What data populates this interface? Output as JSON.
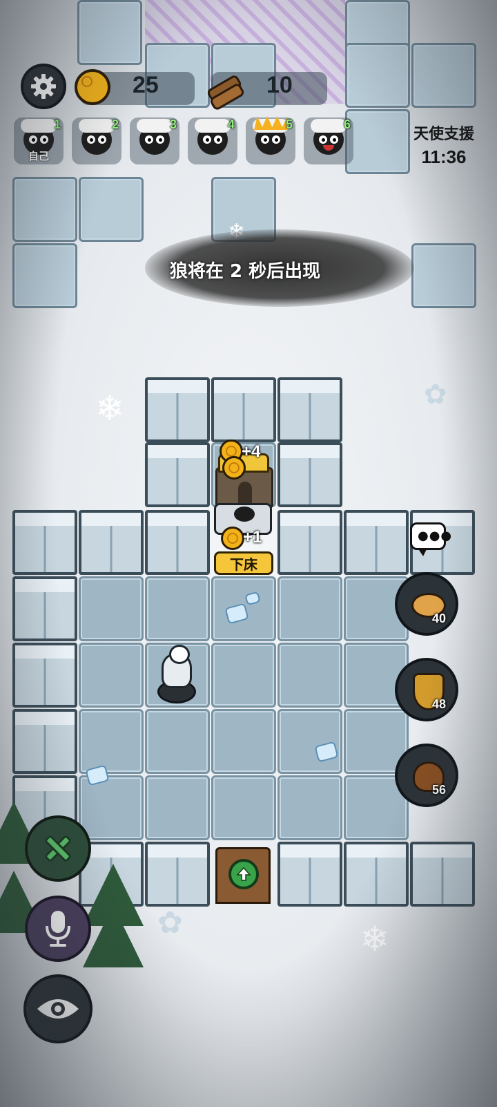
{
  "hud": {
    "coins": "25",
    "wood": "10"
  },
  "players": [
    {
      "num": "1",
      "label": "自己"
    },
    {
      "num": "2",
      "label": ""
    },
    {
      "num": "3",
      "label": ""
    },
    {
      "num": "4",
      "label": ""
    },
    {
      "num": "5",
      "label": ""
    },
    {
      "num": "6",
      "label": ""
    }
  ],
  "angel_support": {
    "title": "天使支援",
    "time": "11:36"
  },
  "notice": "狼将在 2 秒后出现",
  "bed": {
    "gain_top": "+4",
    "gain_bottom": "+1",
    "button": "下床"
  },
  "side_items": [
    {
      "name": "piggy-bank",
      "count": "40"
    },
    {
      "name": "shield",
      "count": "48"
    },
    {
      "name": "poop",
      "count": "56"
    }
  ],
  "icons": {
    "settings": "gear-icon",
    "coin": "coin-icon",
    "wood": "wood-log-icon",
    "chat": "chat-bubble-icon",
    "build": "tools-icon",
    "mic": "microphone-icon",
    "eye": "eye-icon",
    "gate": "upgrade-arrow-icon"
  },
  "colors": {
    "coin": "#f2b21a",
    "player_num": "#8ef07a",
    "bed_button": "#f5c53a",
    "upgrade_green": "#39a34a"
  }
}
